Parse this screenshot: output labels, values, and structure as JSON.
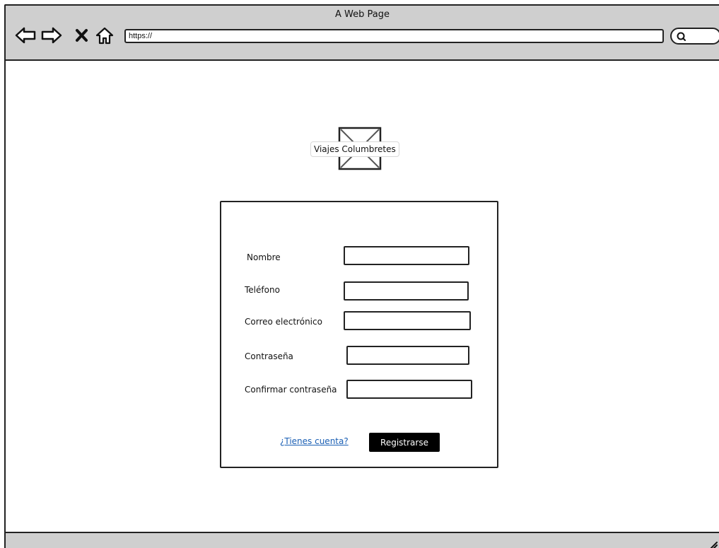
{
  "window": {
    "title": "A Web Page"
  },
  "toolbar": {
    "icons": [
      "back-arrow-icon",
      "forward-arrow-icon",
      "close-x-icon",
      "home-icon"
    ],
    "url_value": "https://",
    "search_icon": "search-icon"
  },
  "logo": {
    "image": "image-placeholder-icon",
    "label": "Viajes Columbretes"
  },
  "form": {
    "fields": [
      {
        "label": "Nombre",
        "value": ""
      },
      {
        "label": "Teléfono",
        "value": ""
      },
      {
        "label": "Correo electrónico",
        "value": ""
      },
      {
        "label": "Contraseña",
        "value": ""
      },
      {
        "label": "Confirmar contraseña",
        "value": ""
      }
    ],
    "account_link": "¿Tienes cuenta?",
    "register_button": "Registrarse"
  },
  "colors": {
    "chrome": "#cfcfcf",
    "link": "#1a5fb4",
    "button_bg": "#000000",
    "button_text": "#ffffff"
  }
}
